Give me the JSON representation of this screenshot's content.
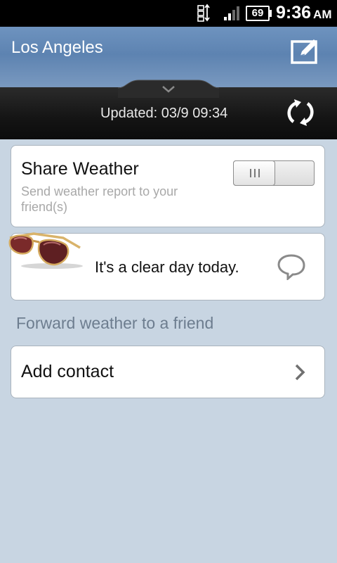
{
  "status_bar": {
    "network_icon": "network-activity-icon",
    "signal_icon": "signal-strength-icon",
    "battery_level": "69",
    "time": "9:36",
    "ampm": "AM"
  },
  "header": {
    "city": "Los Angeles",
    "edit_icon": "edit-icon",
    "updated_text": "Updated: 03/9 09:34",
    "refresh_icon": "refresh-icon",
    "pull_icon": "chevron-down-icon"
  },
  "share_weather": {
    "title": "Share Weather",
    "subtitle": "Send weather report to your friend(s)",
    "toggle_on": false
  },
  "weather_message": {
    "text": "It's a clear day today.",
    "image_icon": "sunglasses-icon",
    "comment_icon": "comment-icon"
  },
  "forward_section": {
    "label": "Forward weather to a friend"
  },
  "add_contact": {
    "label": "Add contact",
    "chevron_icon": "chevron-right-icon"
  },
  "colors": {
    "background": "#c8d5e2",
    "header_blue": "#6e93bf",
    "dark_band": "#141414",
    "section_label": "#6d7d8f",
    "subtitle_gray": "#a8a8a8"
  }
}
